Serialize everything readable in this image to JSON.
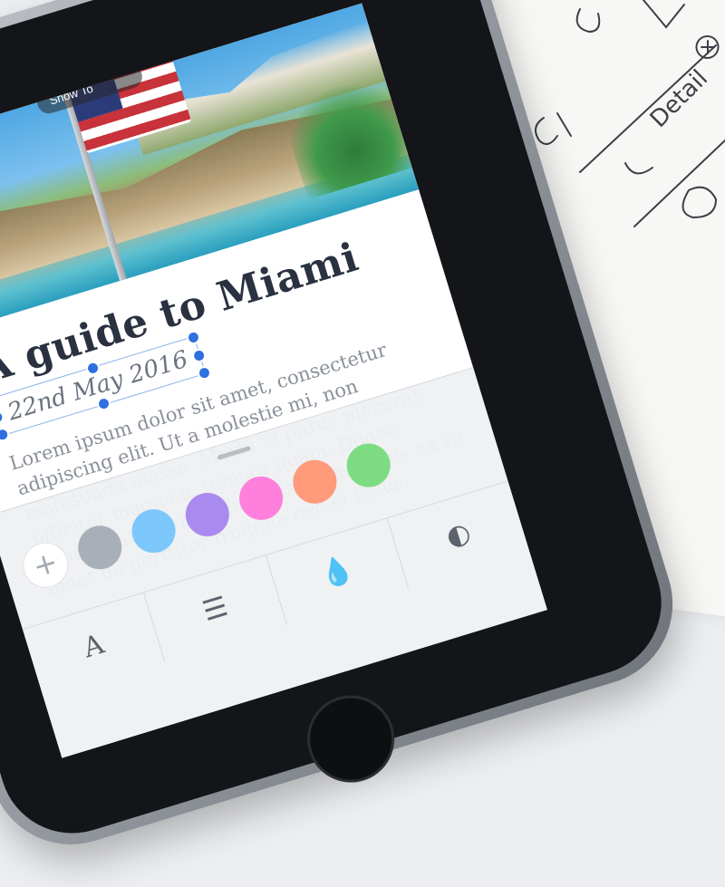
{
  "overlay": {
    "pill_text": "Show To"
  },
  "article": {
    "title": "A guide to Miami",
    "date": "22nd May 2016",
    "body": "Lorem ipsum dolor sit amet, consectetur adipiscing elit. Ut a molestie mi, non malesuada massa. Morbi id purus placerat, efficitur magna a, tempor quam. Donec consequat tristique facilisis. Donec quis ex sit amet mi porttitor fringilla nec et lacus."
  },
  "panel": {
    "add_label": "+",
    "swatches": [
      {
        "name": "gray",
        "color": "#a9afb8"
      },
      {
        "name": "blue",
        "color": "#7cc7fb"
      },
      {
        "name": "purple",
        "color": "#a98bef"
      },
      {
        "name": "pink",
        "color": "#ff7fdc"
      },
      {
        "name": "orange",
        "color": "#ff9a7a"
      },
      {
        "name": "green",
        "color": "#7ddc82"
      }
    ],
    "tools": [
      {
        "name": "text-tool",
        "glyph": "A"
      },
      {
        "name": "align-tool",
        "glyph": "☰"
      },
      {
        "name": "ink-tool",
        "glyph": "💧"
      },
      {
        "name": "contrast-tool",
        "glyph": "◐"
      }
    ]
  },
  "sketch_notes": {
    "word1": "Detail"
  }
}
